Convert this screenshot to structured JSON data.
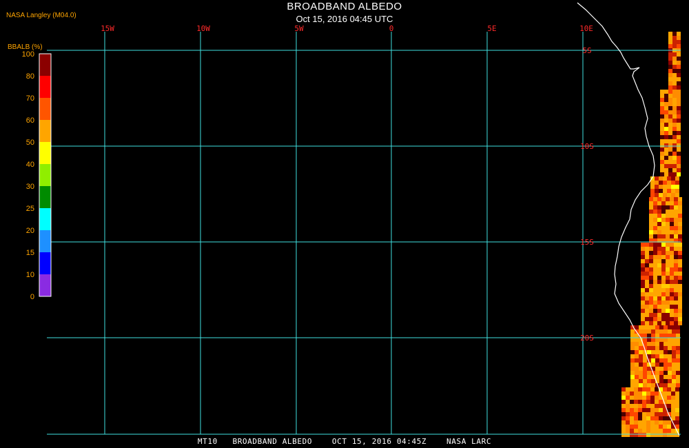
{
  "header": {
    "title": "BROADBAND ALBEDO",
    "subtitle": "Oct 15, 2016 04:45 UTC",
    "credit": "NASA Langley (M04.0)"
  },
  "footer": {
    "caption": "MT10   BROADBAND ALBEDO    OCT 15, 2016 04:45Z    NASA LARC"
  },
  "map": {
    "grid_color": "#40e0e0",
    "label_color": "#ff2a2a",
    "coast_color": "#ffffff",
    "lon_labels": [
      "15W",
      "10W",
      "5W",
      "0",
      "5E",
      "10E"
    ],
    "lat_labels": [
      "5S",
      "10S",
      "15S",
      "20S"
    ]
  },
  "colorbar": {
    "label": "BBALB (%)",
    "text_color": "#ffa500",
    "ticks": [
      "100",
      "80",
      "70",
      "60",
      "50",
      "40",
      "30",
      "25",
      "20",
      "15",
      "10",
      "0"
    ],
    "colors": [
      "#8b0000",
      "#ff0000",
      "#ff5500",
      "#ffa500",
      "#ffff00",
      "#90ee00",
      "#008b00",
      "#00ffff",
      "#1e90ff",
      "#0000ff",
      "#8a2be2"
    ]
  },
  "albedo_palette": [
    "#ffa500",
    "#ff8c00",
    "#ff4500",
    "#cc2200",
    "#8b0000",
    "#4a0000",
    "#ffcc00",
    "#ffff00"
  ]
}
